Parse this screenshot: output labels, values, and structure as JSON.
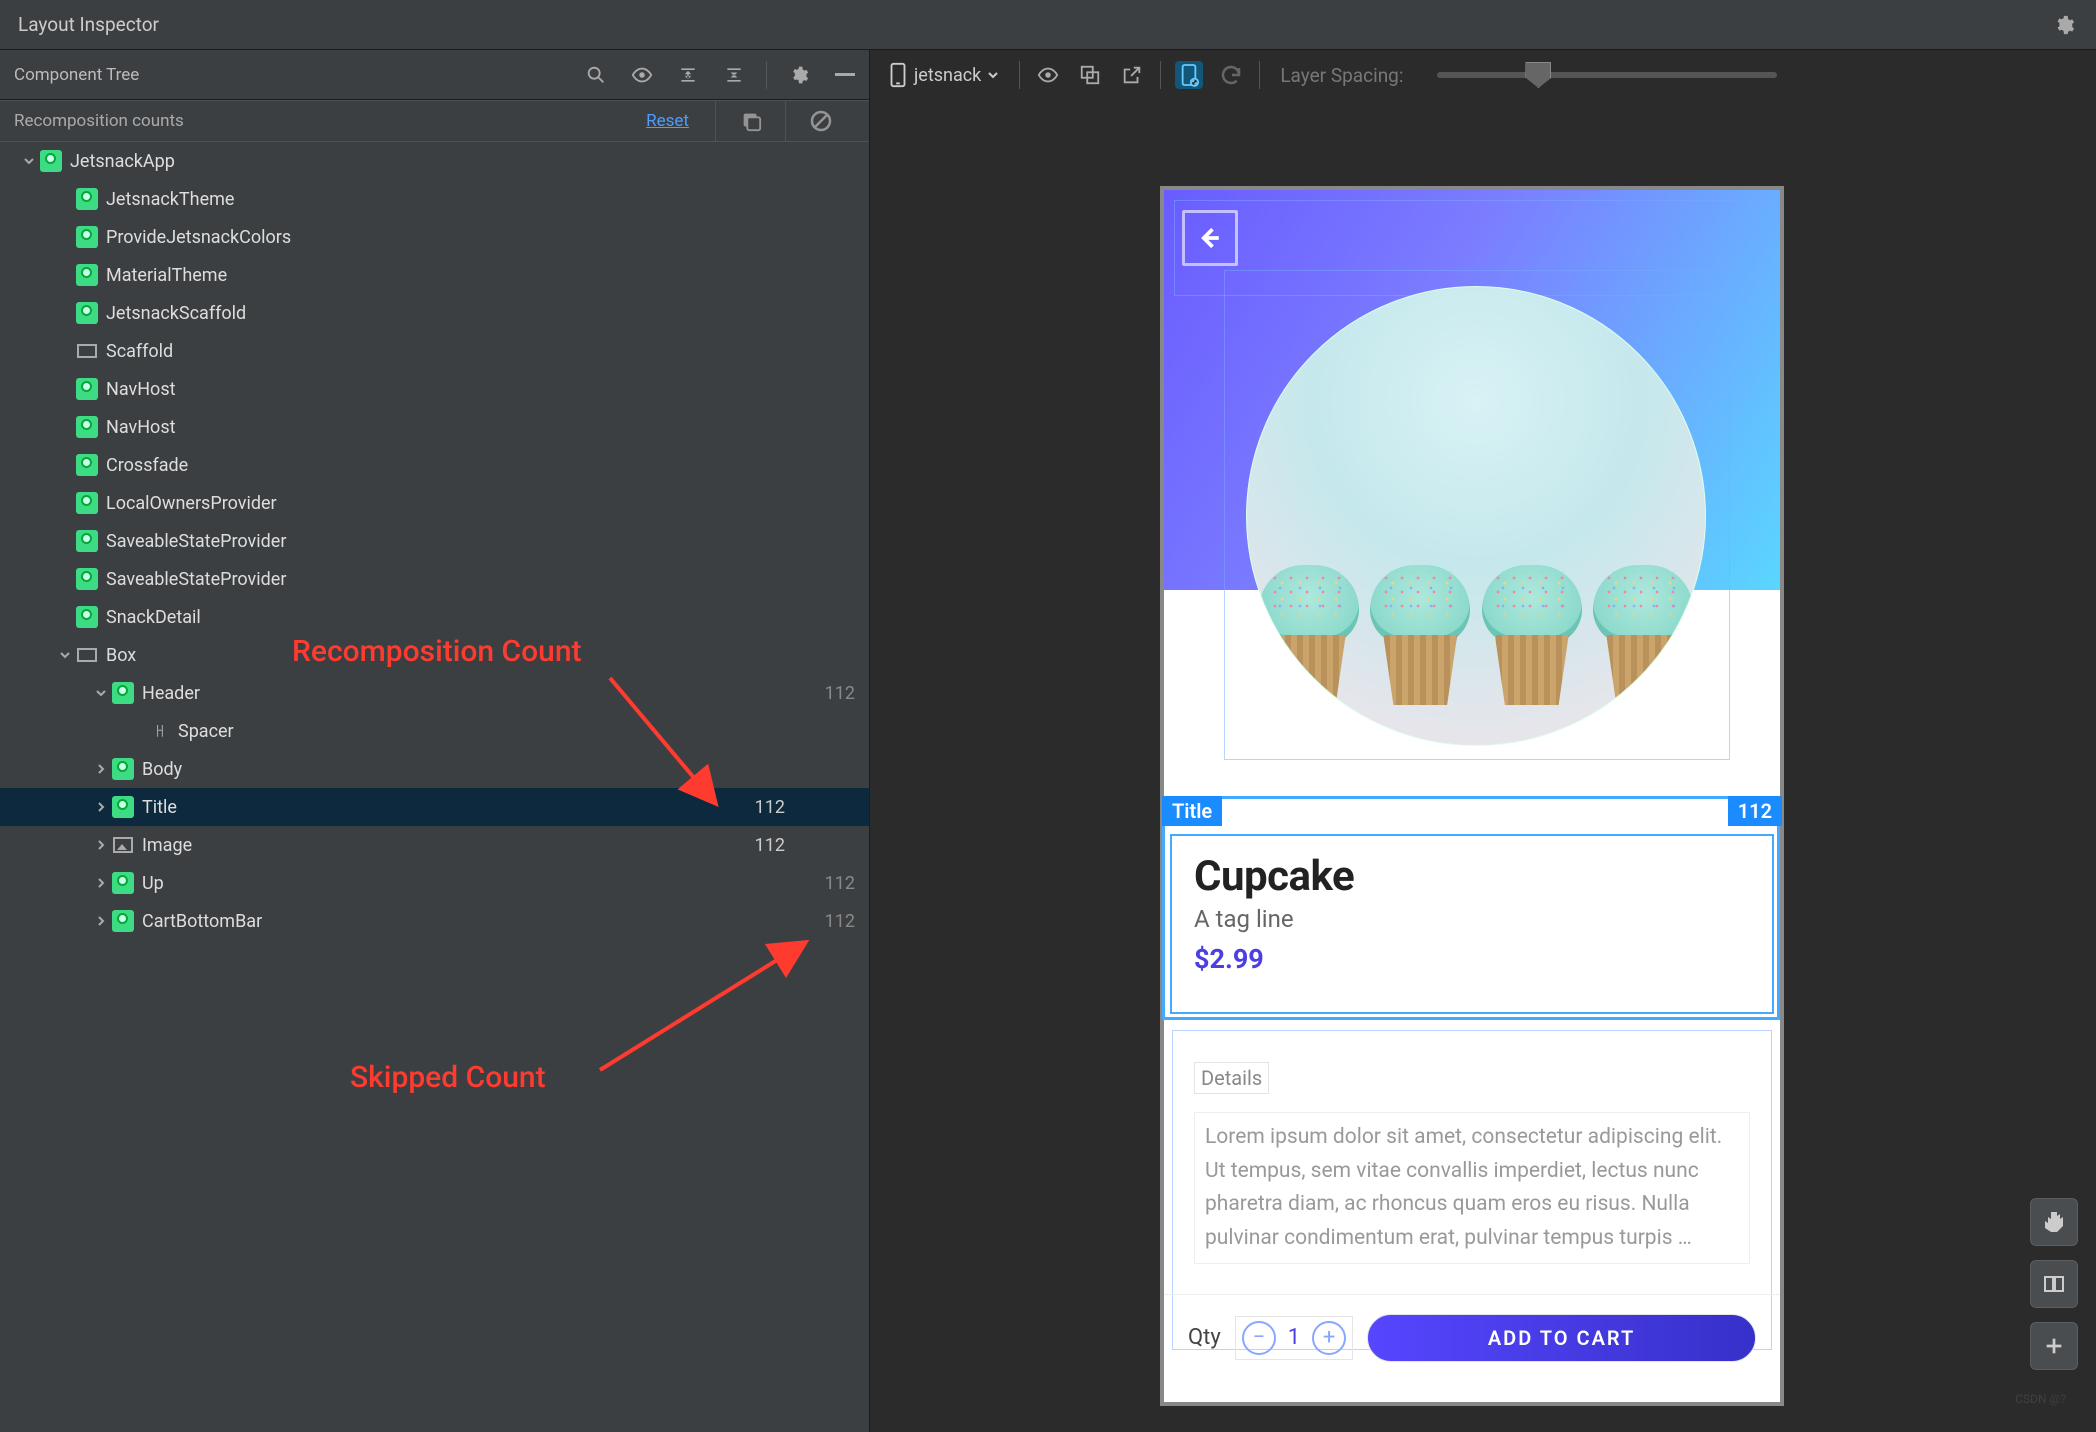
{
  "window": {
    "title": "Layout Inspector"
  },
  "left_toolbar": {
    "label": "Component Tree"
  },
  "subheader": {
    "label": "Recomposition counts",
    "reset": "Reset"
  },
  "tree": [
    {
      "depth": 0,
      "chev": "down",
      "icon": "compose",
      "name": "JetsnackApp"
    },
    {
      "depth": 1,
      "icon": "compose",
      "name": "JetsnackTheme"
    },
    {
      "depth": 1,
      "icon": "compose",
      "name": "ProvideJetsnackColors"
    },
    {
      "depth": 1,
      "icon": "compose",
      "name": "MaterialTheme"
    },
    {
      "depth": 1,
      "icon": "compose",
      "name": "JetsnackScaffold"
    },
    {
      "depth": 1,
      "icon": "box",
      "name": "Scaffold"
    },
    {
      "depth": 1,
      "icon": "compose",
      "name": "NavHost"
    },
    {
      "depth": 1,
      "icon": "compose",
      "name": "NavHost"
    },
    {
      "depth": 1,
      "icon": "compose",
      "name": "Crossfade"
    },
    {
      "depth": 1,
      "icon": "compose",
      "name": "LocalOwnersProvider"
    },
    {
      "depth": 1,
      "icon": "compose",
      "name": "SaveableStateProvider"
    },
    {
      "depth": 1,
      "icon": "compose",
      "name": "SaveableStateProvider"
    },
    {
      "depth": 1,
      "icon": "compose",
      "name": "SnackDetail"
    },
    {
      "depth": 1,
      "chev": "down",
      "icon": "box",
      "name": "Box"
    },
    {
      "depth": 2,
      "chev": "down",
      "icon": "compose",
      "name": "Header",
      "skip": "112"
    },
    {
      "depth": 3,
      "icon": "spacer",
      "name": "Spacer"
    },
    {
      "depth": 2,
      "chev": "right",
      "icon": "compose",
      "name": "Body"
    },
    {
      "depth": 2,
      "chev": "right",
      "icon": "compose",
      "name": "Title",
      "count": "112",
      "selected": true
    },
    {
      "depth": 2,
      "chev": "right",
      "icon": "image",
      "name": "Image",
      "count": "112"
    },
    {
      "depth": 2,
      "chev": "right",
      "icon": "compose",
      "name": "Up",
      "skip": "112"
    },
    {
      "depth": 2,
      "chev": "right",
      "icon": "compose",
      "name": "CartBottomBar",
      "skip": "112"
    }
  ],
  "right_toolbar": {
    "device": "jetsnack",
    "layer_label": "Layer Spacing:"
  },
  "preview": {
    "sel_label_left": "Title",
    "sel_label_right": "112",
    "product_title": "Cupcake",
    "tagline": "A tag line",
    "price": "$2.99",
    "details_heading": "Details",
    "details_body": "Lorem ipsum dolor sit amet, consectetur adipiscing elit. Ut tempus, sem vitae convallis imperdiet, lectus nunc pharetra diam, ac rhoncus quam eros eu risus. Nulla pulvinar condimentum erat, pulvinar tempus turpis …",
    "qty_label": "Qty",
    "qty_value": "1",
    "add_label": "ADD TO CART"
  },
  "annotations": {
    "recomp": "Recomposition Count",
    "skipped": "Skipped Count"
  },
  "watermark": "CSDN @?"
}
